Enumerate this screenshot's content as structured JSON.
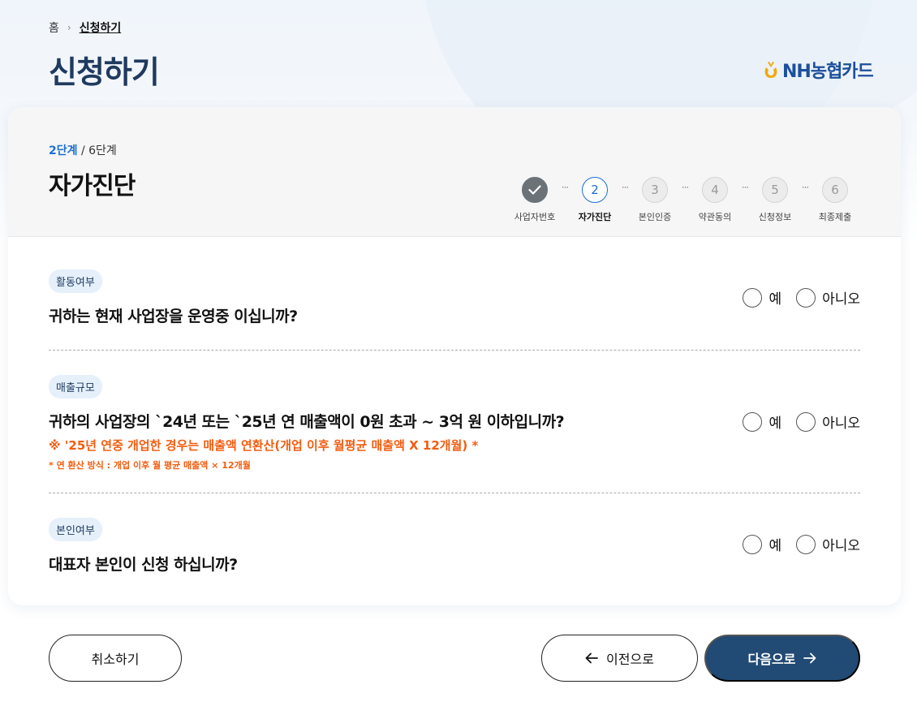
{
  "breadcrumb": {
    "home": "홈",
    "separator": "›",
    "current": "신청하기"
  },
  "page_title": "신청하기",
  "logo": {
    "text": "NH농협카드",
    "icon": "nh-logo-icon",
    "color": "#1c4f9c"
  },
  "step_header": {
    "current": "2단계",
    "total": " / 6단계",
    "title": "자가진단"
  },
  "stepper": [
    {
      "number": "1",
      "label": "사업자번호",
      "state": "done",
      "icon": "check-icon"
    },
    {
      "number": "2",
      "label": "자가진단",
      "state": "active"
    },
    {
      "number": "3",
      "label": "본인인증",
      "state": "pending"
    },
    {
      "number": "4",
      "label": "약관동의",
      "state": "pending"
    },
    {
      "number": "5",
      "label": "신청정보",
      "state": "pending"
    },
    {
      "number": "6",
      "label": "최종제출",
      "state": "pending"
    }
  ],
  "stepper_separator": "···",
  "questions": [
    {
      "tag": "활동여부",
      "text": "귀하는 현재 사업장을 운영중 이십니까?",
      "yes": "예",
      "no": "아니오"
    },
    {
      "tag": "매출규모",
      "text": "귀하의 사업장의 `24년 또는 `25년 연 매출액이 0원 초과 ~ 3억 원 이하입니까?",
      "note1": "※ '25년 연중 개업한 경우는 매출액 연환산(개업 이후 월평균 매출액 X 12개월) *",
      "note2": "* 연 환산 방식 : 개업 이후 월 평균 매출액 × 12개월",
      "yes": "예",
      "no": "아니오"
    },
    {
      "tag": "본인여부",
      "text": "대표자 본인이 신청 하십니까?",
      "yes": "예",
      "no": "아니오"
    }
  ],
  "buttons": {
    "cancel": "취소하기",
    "prev": "이전으로",
    "next": "다음으로"
  },
  "colors": {
    "primary": "#214a74",
    "accent_blue": "#1d6fd1",
    "warning": "#f25d10",
    "title": "#1f3a5f"
  }
}
